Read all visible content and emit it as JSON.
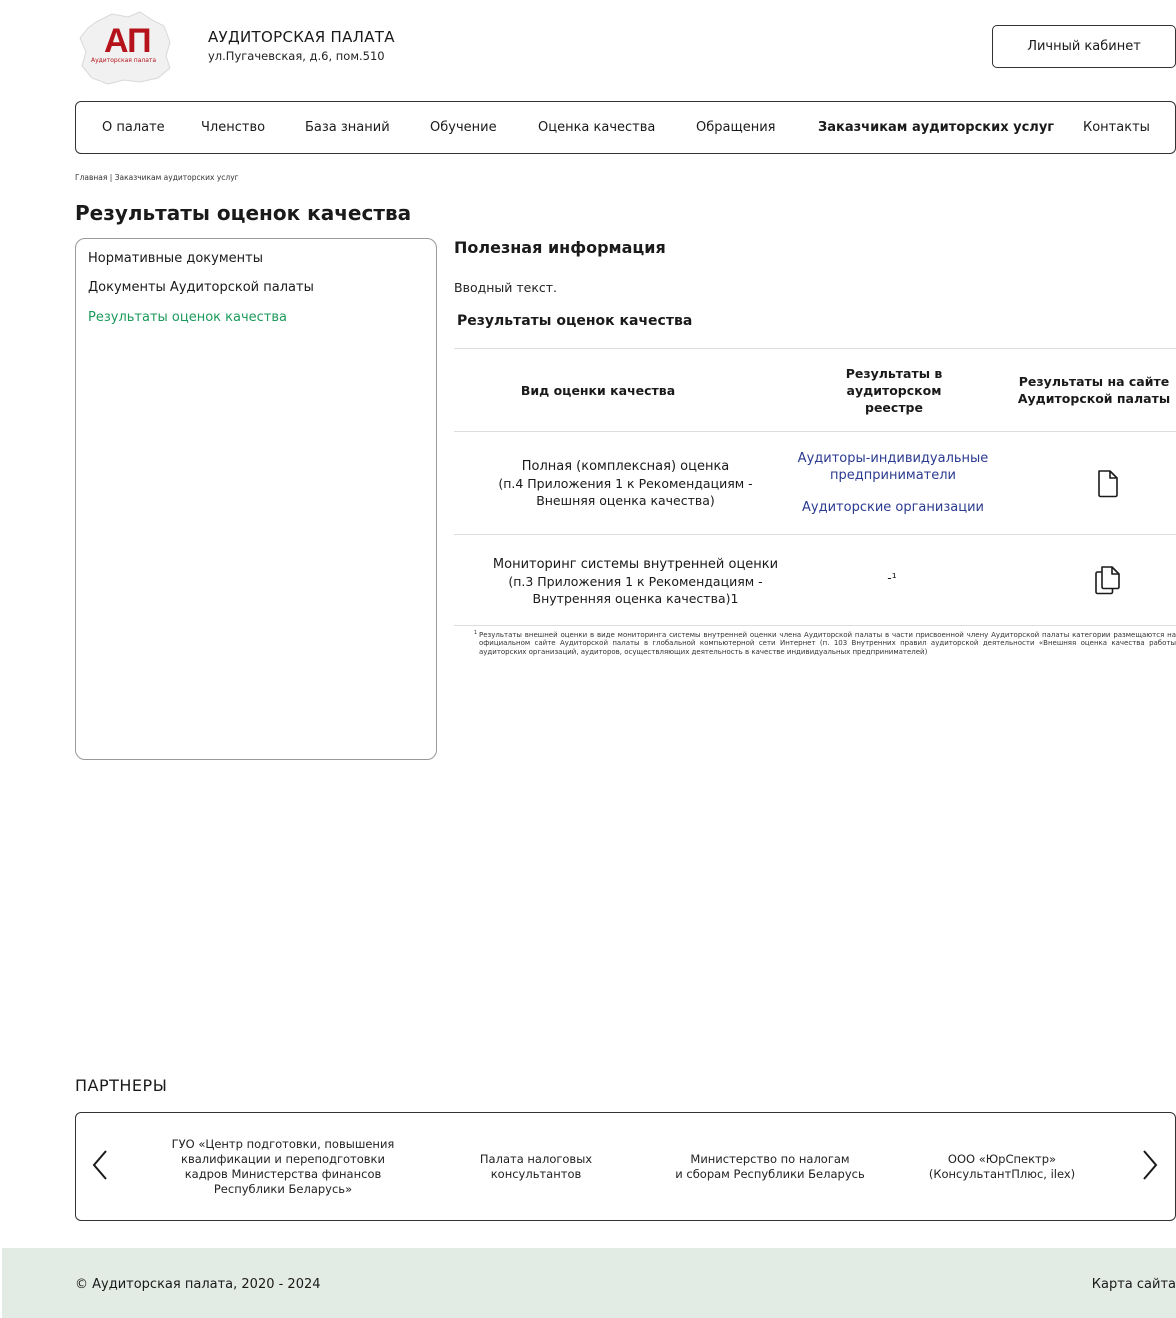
{
  "header": {
    "logo_letters": "АП",
    "logo_caption": "Аудиторская палата",
    "org_name": "АУДИТОРСКАЯ ПАЛАТА",
    "address": "ул.Пугачевская, д.6, пом.510",
    "cabinet_label": "Личный кабинет",
    "brand_color": "#b5121b"
  },
  "nav": {
    "items": [
      {
        "label": "О палате"
      },
      {
        "label": "Членство"
      },
      {
        "label": "База знаний"
      },
      {
        "label": "Обучение"
      },
      {
        "label": "Оценка качества"
      },
      {
        "label": "Обращения"
      },
      {
        "label": "Заказчикам аудиторских услуг",
        "active": true
      },
      {
        "label": "Контакты"
      }
    ]
  },
  "breadcrumb": "Главная | Заказчикам аудиторских услуг",
  "page_title": "Результаты оценок качества",
  "sidebar": {
    "items": [
      {
        "label": "Нормативные документы"
      },
      {
        "label": "Документы Аудиторской палаты"
      },
      {
        "label": "Результаты оценок качества",
        "active": true
      }
    ],
    "active_color": "#1b9a5a"
  },
  "main": {
    "section_heading": "Полезная информация",
    "intro": "Вводный текст.",
    "table_title": "Результаты оценок качества",
    "table": {
      "headers": [
        "Вид оценки качества",
        "Результаты в аудиторском реестре",
        "Результаты на сайте Аудиторской палаты"
      ],
      "rows": [
        {
          "type_line1": "Полная (комплексная) оценка",
          "type_line2": "(п.4 Приложения 1 к Рекомендациям -",
          "type_line3": "Внешняя оценка качества)",
          "link1": "Аудиторы-индивидуальные предприниматели",
          "link2": "Аудиторские организации",
          "icon": "document-icon"
        },
        {
          "type_line1": "Мониторинг системы внутренней оценки",
          "type_line2": "(п.3 Приложения 1 к Рекомендациям -",
          "type_line3": "Внутренняя оценка качества)1",
          "registry_value": "-¹",
          "icon": "documents-copy-icon"
        }
      ],
      "link_color": "#2a3a8f"
    },
    "footnote_mark": "1",
    "footnote": "Результаты внешней оценки в виде мониторинга системы внутренней оценки члена Аудиторской палаты в части присвоенной члену Аудиторской палаты категории размещаются на официальном сайте Аудиторской палаты в глобальной компьютерной сети Интернет (п. 103 Внутренних правил аудиторской деятельности «Внешняя оценка качества работы аудиторских организаций, аудиторов, осуществляющих деятельность в качестве индивидуальных предпринимателей)"
  },
  "partners": {
    "heading": "ПАРТНЕРЫ",
    "items": [
      {
        "line1": "ГУО «Центр подготовки, повышения",
        "line2": "квалификации и переподготовки",
        "line3": "кадров Министерства финансов",
        "line4": "Республики Беларусь»"
      },
      {
        "line1": "Палата налоговых",
        "line2": "консультантов"
      },
      {
        "line1": "Министерство по налогам",
        "line2": "и сборам Республики Беларусь"
      },
      {
        "line1": "ООО «ЮрСпектр»",
        "line2": "(КонсультантПлюс, ilex)"
      }
    ]
  },
  "footer": {
    "copyright": "© Аудиторская палата, 2020 - 2024",
    "sitemap": "Карта сайта",
    "background": "#e3ebe5"
  }
}
